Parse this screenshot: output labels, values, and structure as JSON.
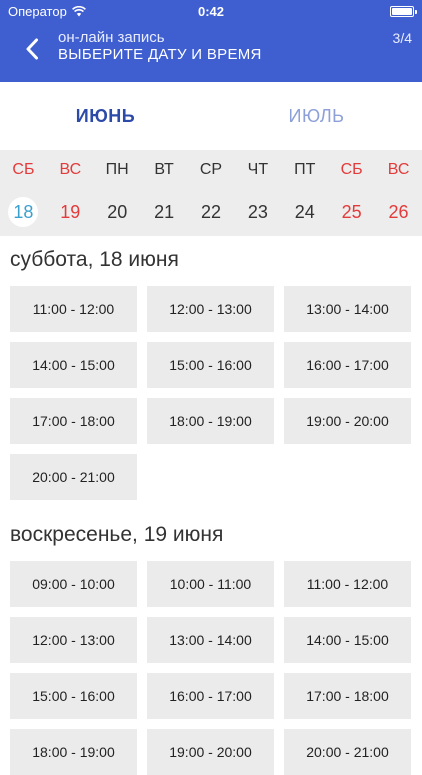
{
  "status_bar": {
    "carrier": "Оператор",
    "time": "0:42"
  },
  "header": {
    "subtitle": "он-лайн запись",
    "title": "ВЫБЕРИТЕ ДАТУ И ВРЕМЯ",
    "step": "3/4"
  },
  "months": {
    "active": "ИЮНЬ",
    "inactive": "ИЮЛЬ"
  },
  "calendar": {
    "days": [
      {
        "weekday": "СБ",
        "number": "18",
        "weekend": true,
        "selected": true
      },
      {
        "weekday": "ВС",
        "number": "19",
        "weekend": true,
        "selected": false
      },
      {
        "weekday": "ПН",
        "number": "20",
        "weekend": false,
        "selected": false
      },
      {
        "weekday": "ВТ",
        "number": "21",
        "weekend": false,
        "selected": false
      },
      {
        "weekday": "СР",
        "number": "22",
        "weekend": false,
        "selected": false
      },
      {
        "weekday": "ЧТ",
        "number": "23",
        "weekend": false,
        "selected": false
      },
      {
        "weekday": "ПТ",
        "number": "24",
        "weekend": false,
        "selected": false
      },
      {
        "weekday": "СБ",
        "number": "25",
        "weekend": true,
        "selected": false
      },
      {
        "weekday": "ВС",
        "number": "26",
        "weekend": true,
        "selected": false
      }
    ]
  },
  "schedule": {
    "saturday": {
      "heading": "суббота, 18 июня",
      "slots": [
        "11:00 - 12:00",
        "12:00 - 13:00",
        "13:00 - 14:00",
        "14:00 - 15:00",
        "15:00 - 16:00",
        "16:00 - 17:00",
        "17:00 - 18:00",
        "18:00 - 19:00",
        "19:00 - 20:00",
        "20:00 - 21:00"
      ]
    },
    "sunday": {
      "heading": "воскресенье, 19 июня",
      "slots": [
        "09:00 - 10:00",
        "10:00 - 11:00",
        "11:00 - 12:00",
        "12:00 - 13:00",
        "13:00 - 14:00",
        "14:00 - 15:00",
        "15:00 - 16:00",
        "16:00 - 17:00",
        "17:00 - 18:00",
        "18:00 - 19:00",
        "19:00 - 20:00",
        "20:00 - 21:00"
      ]
    }
  },
  "icons": {
    "back": "chevron-left-icon",
    "wifi": "wifi-icon",
    "battery": "battery-icon"
  },
  "colors": {
    "header": "#3f5fd1",
    "weekend": "#e33b3b",
    "selected_day": "#3aa0d0",
    "active_month": "#2c4aa8",
    "inactive_month": "#8da0d8",
    "slot_bg": "#ebebeb"
  }
}
